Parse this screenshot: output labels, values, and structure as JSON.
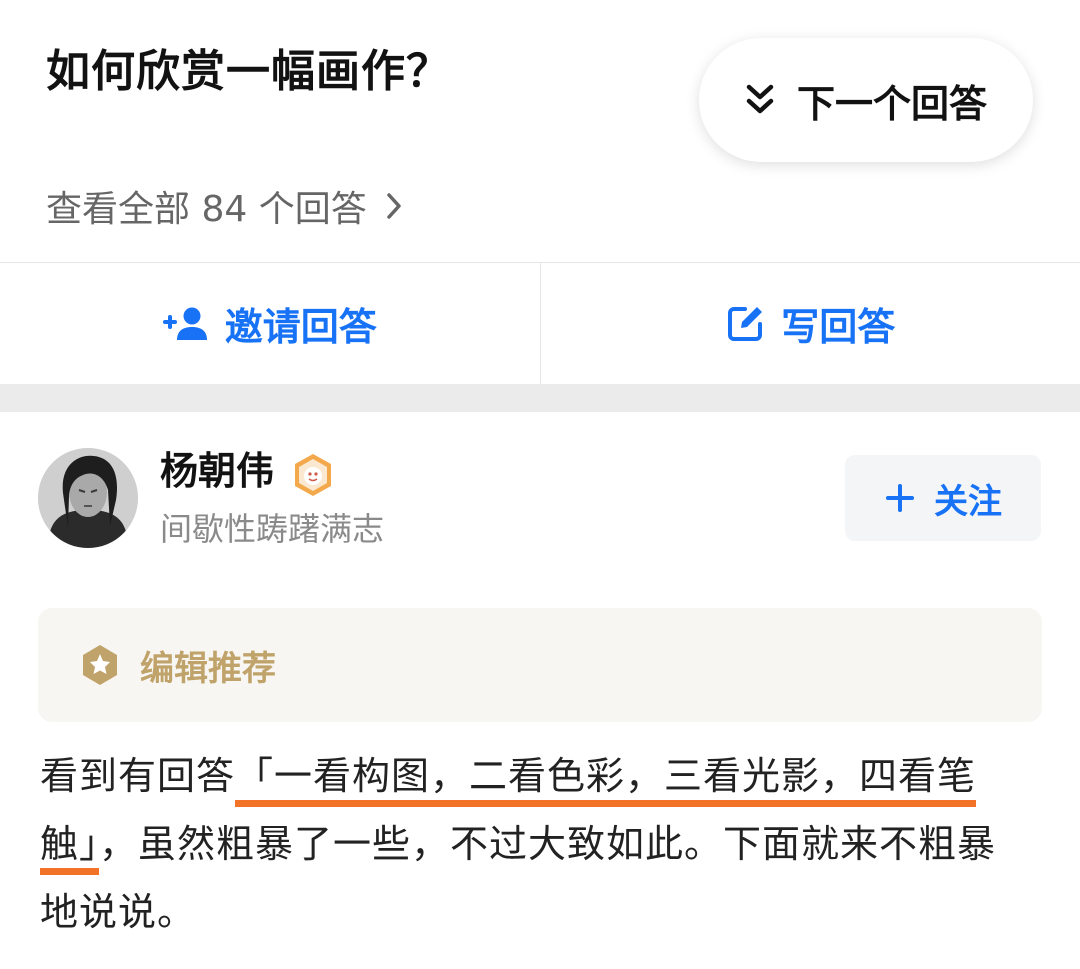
{
  "question": {
    "title": "如何欣赏一幅画作？",
    "view_all_label": "查看全部 84 个回答",
    "next_answer_label": "下一个回答"
  },
  "actions": {
    "invite_label": "邀请回答",
    "write_label": "写回答"
  },
  "author": {
    "name": "杨朝伟",
    "bio": "间歇性踌躇满志",
    "follow_label": "关注"
  },
  "editor_pick_label": "编辑推荐",
  "body": {
    "before": "看到有回答",
    "highlight": "「一看构图，二看色彩，三看光影，四看笔触」",
    "after": "，虽然粗暴了一些，不过大致如此。下面就来不粗暴地说说。"
  },
  "colors": {
    "brand_blue": "#1772f6",
    "highlight_orange": "#f27227",
    "editor_gold": "#c0a36a"
  },
  "icons": {
    "next": "double-chevron-down-icon",
    "view_all": "chevron-right-icon",
    "invite": "add-user-icon",
    "write": "edit-icon",
    "badge": "achievement-badge-icon",
    "follow": "plus-icon",
    "editor": "star-hexagon-icon"
  }
}
